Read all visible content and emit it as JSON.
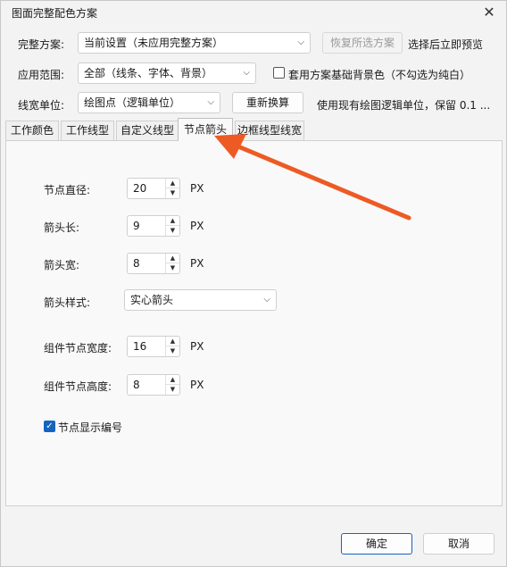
{
  "window": {
    "title": "图面完整配色方案",
    "close_glyph": "✕"
  },
  "scheme": {
    "label": "完整方案:",
    "value": "当前设置（未应用完整方案）",
    "restore_label": "恢复所选方案",
    "preview_text": "选择后立即预览"
  },
  "scope": {
    "label": "应用范围:",
    "value": "全部（线条、字体、背景）",
    "bg_checkbox_label": "套用方案基础背景色（不勾选为纯白）",
    "bg_checked": false
  },
  "linewidth": {
    "label": "线宽单位:",
    "value": "绘图点（逻辑单位）",
    "recalc_label": "重新换算",
    "hint": "使用现有绘图逻辑单位，保留 0.1 ..."
  },
  "tabs": [
    {
      "label": "工作颜色"
    },
    {
      "label": "工作线型"
    },
    {
      "label": "自定义线型"
    },
    {
      "label": "节点箭头"
    },
    {
      "label": "边框线型线宽"
    }
  ],
  "active_tab": "节点箭头",
  "fields": {
    "node_diameter": {
      "label": "节点直径:",
      "value": "20",
      "unit": "PX"
    },
    "arrow_length": {
      "label": "箭头长:",
      "value": "9",
      "unit": "PX"
    },
    "arrow_width": {
      "label": "箭头宽:",
      "value": "8",
      "unit": "PX"
    },
    "arrow_style": {
      "label": "箭头样式:",
      "value": "实心箭头"
    },
    "comp_node_width": {
      "label": "组件节点宽度:",
      "value": "16",
      "unit": "PX"
    },
    "comp_node_height": {
      "label": "组件节点高度:",
      "value": "8",
      "unit": "PX"
    }
  },
  "show_number": {
    "label": "节点显示编号",
    "checked": true
  },
  "footer": {
    "ok_label": "确定",
    "cancel_label": "取消"
  },
  "glyphs": {
    "dropdown": "⌵",
    "spin_up": "▲",
    "spin_down": "▼",
    "check": "✓"
  },
  "colors": {
    "accent": "#1565c0",
    "annotation_arrow": "#ee5a24"
  }
}
